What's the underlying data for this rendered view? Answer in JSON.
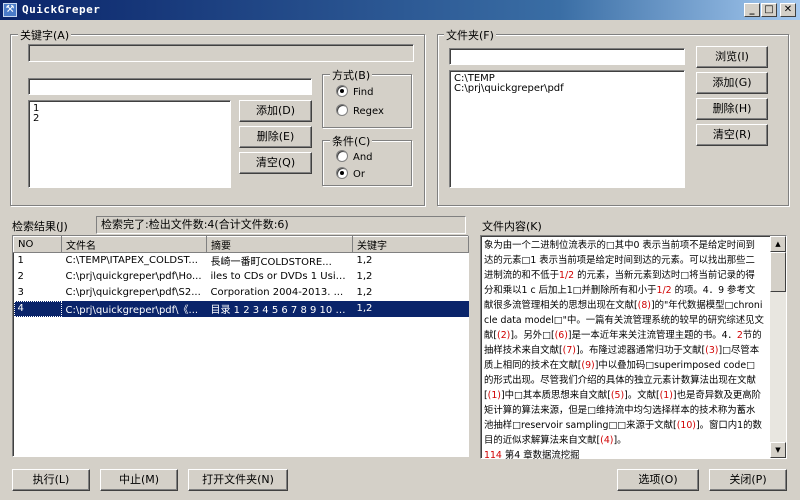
{
  "window": {
    "title": "QuickGreper",
    "icon": "app-icon",
    "minimize": "_",
    "maximize": "□",
    "close": "✕"
  },
  "keywords": {
    "group_label": "关键字(A)",
    "input_value": "",
    "list_items": [
      "1",
      "2"
    ],
    "add_label": "添加(D)",
    "delete_label": "删除(E)",
    "clear_label": "清空(Q)",
    "mode": {
      "label": "方式(B)",
      "options": [
        "Find",
        "Regex"
      ],
      "selected": "Find"
    },
    "condition": {
      "label": "条件(C)",
      "options": [
        "And",
        "Or"
      ],
      "selected": "Or"
    }
  },
  "folders": {
    "group_label": "文件夹(F)",
    "input_value": "",
    "list_items": [
      "C:\\TEMP",
      "C:\\prj\\quickgreper\\pdf"
    ],
    "browse_label": "浏览(I)",
    "add_label": "添加(G)",
    "delete_label": "删除(H)",
    "clear_label": "清空(R)"
  },
  "results": {
    "label": "检索结果(J)",
    "status": "检索完了:检出文件数:4(合计文件数:6)",
    "columns": [
      "NO",
      "文件名",
      "摘要",
      "关键字"
    ],
    "rows": [
      {
        "no": "1",
        "file": "C:\\TEMP\\ITAPEX_COLDST...",
        "summary": "長崎一番町COLDSTORE...",
        "keywords": "1,2"
      },
      {
        "no": "2",
        "file": "C:\\prj\\quickgreper\\pdf\\Ho...",
        "summary": "iles to CDs or DVDs 1 Usin...",
        "keywords": "1,2"
      },
      {
        "no": "3",
        "file": "C:\\prj\\quickgreper\\pdf\\S2...",
        "summary": " Corporation 2004-2013. ...",
        "keywords": "1,2"
      },
      {
        "no": "4",
        "file": "C:\\prj\\quickgreper\\pdf\\《...",
        "summary": "目录 1 2 3 4 5 6 7 8 9 10 1...",
        "keywords": "1,2"
      }
    ],
    "selected_row": 3
  },
  "content": {
    "label": "文件内容(K)",
    "segments": [
      {
        "t": "象为由一个二进制位流表示的□其中0 表示当前项不是给定时间到达的元素□1 表示当前项是给定时间到达的元素。可以找出那些二进制流的和不低于"
      },
      {
        "t": "1/2",
        "red": true
      },
      {
        "t": " 的元素，当新元素到达时□将当前记录的得分和乘以1 c 后加上1□并删除所有和小于"
      },
      {
        "t": "1/2",
        "red": true
      },
      {
        "t": " 的项。4．9 参考文献很多流管理相关的思想出现在文献["
      },
      {
        "t": "(8)",
        "red": true
      },
      {
        "t": "]的\"年代数据模型□chronicle data model□\"中。一篇有关流管理系统的较早的研究综述见文献["
      },
      {
        "t": "(2)",
        "red": true
      },
      {
        "t": "]。另外□["
      },
      {
        "t": "(6)",
        "red": true
      },
      {
        "t": "]是一本近年来关注流管理主题的书。4．"
      },
      {
        "t": "2",
        "red": true
      },
      {
        "t": "节的抽样技术来自文献["
      },
      {
        "t": "(7)",
        "red": true
      },
      {
        "t": "]。布隆过滤器通常归功于文献["
      },
      {
        "t": "(3)",
        "red": true
      },
      {
        "t": "]□尽管本质上相同的技术在文献["
      },
      {
        "t": "(9)",
        "red": true
      },
      {
        "t": "]中以叠加码□superimposed code□的形式出现。尽管我们介绍的具体的独立元素计数算法出现在文献["
      },
      {
        "t": "(1)",
        "red": true
      },
      {
        "t": "]中□其本质思想来自文献["
      },
      {
        "t": "(5)",
        "red": true
      },
      {
        "t": "]。文献["
      },
      {
        "t": "(1)",
        "red": true
      },
      {
        "t": "]也是奇异数及更高阶矩计算的算法来源，但是□维持流中均匀选择样本的技术称为蓄水池抽样□reservoir sampling□□来源于文献["
      },
      {
        "t": "(10)",
        "red": true
      },
      {
        "t": "]。窗口内1的数目的近似求解算法来自文献["
      },
      {
        "t": "(4)",
        "red": true
      },
      {
        "t": "]。\n"
      },
      {
        "t": "114",
        "red": true
      },
      {
        "t": " 第4 章数据流挖掘"
      }
    ],
    "scroll_up": "▲",
    "scroll_down": "▼"
  },
  "footer": {
    "run_label": "执行(L)",
    "stop_label": "中止(M)",
    "open_folder_label": "打开文件夹(N)",
    "options_label": "选项(O)",
    "close_label": "关闭(P)"
  }
}
